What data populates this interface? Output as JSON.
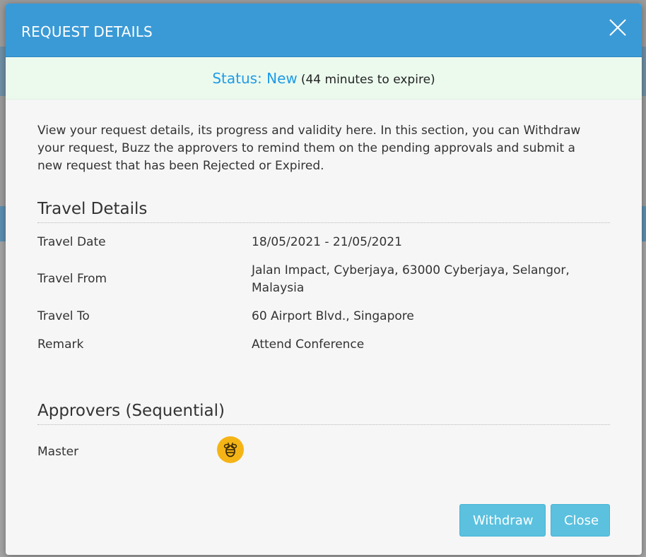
{
  "modal": {
    "title": "REQUEST DETAILS"
  },
  "status": {
    "label": "Status: New",
    "note": "(44 minutes to expire)"
  },
  "intro": "View your request details, its progress and validity here. In this section, you can Withdraw your request, Buzz the approvers to remind them on the pending approvals and submit a new request that has been Rejected or Expired.",
  "travel": {
    "title": "Travel Details",
    "rows": [
      {
        "label": "Travel Date",
        "value": "18/05/2021 - 21/05/2021"
      },
      {
        "label": "Travel From",
        "value": "Jalan Impact, Cyberjaya, 63000 Cyberjaya, Selangor, Malaysia"
      },
      {
        "label": "Travel To",
        "value": "60 Airport Blvd., Singapore"
      },
      {
        "label": "Remark",
        "value": "Attend Conference"
      }
    ]
  },
  "approvers": {
    "title": "Approvers (Sequential)",
    "items": [
      {
        "name": "Master",
        "icon": "bee-icon",
        "color": "#f5b416"
      }
    ]
  },
  "buttons": {
    "withdraw": "Withdraw",
    "close": "Close"
  },
  "colors": {
    "header": "#3a9ad6",
    "status": "#1e9be6",
    "button": "#5bc1df"
  }
}
